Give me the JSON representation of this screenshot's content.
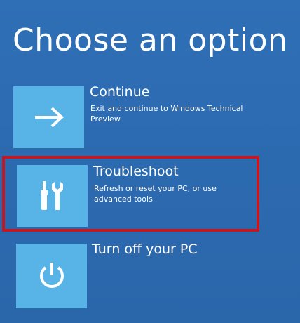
{
  "screen": {
    "title": "Choose an option"
  },
  "options": [
    {
      "title": "Continue",
      "description": "Exit and continue to Windows Technical Preview",
      "icon": "arrow-right-icon"
    },
    {
      "title": "Troubleshoot",
      "description": "Refresh or reset your PC, or use advanced tools",
      "icon": "tools-icon"
    },
    {
      "title": "Turn off your PC",
      "description": "",
      "icon": "power-icon"
    }
  ],
  "colors": {
    "background": "#2c6ab0",
    "tile": "#58b3e6",
    "highlight": "#c8161e"
  }
}
